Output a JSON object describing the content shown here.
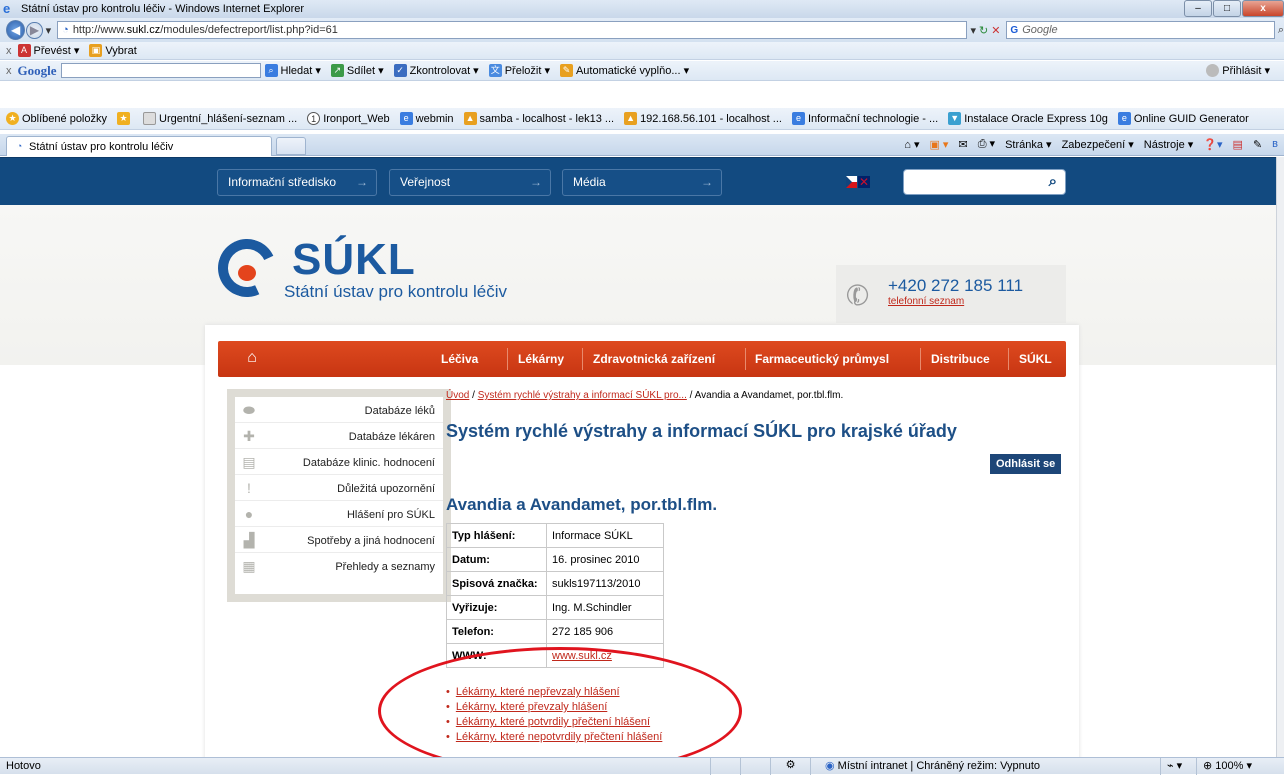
{
  "window": {
    "title": "Státní ústav pro kontrolu léčiv - Windows Internet Explorer"
  },
  "address": {
    "url_prefix": "http://www.",
    "url_host": "sukl.cz",
    "url_path": "/modules/defectreport/list.php?id=61",
    "search_placeholder": "Google"
  },
  "toolbar1": {
    "convert": "Převést",
    "select": "Vybrat"
  },
  "google_toolbar": {
    "logo": "Google",
    "search": "Hledat",
    "share": "Sdílet",
    "check": "Zkontrolovat",
    "translate": "Přeložit",
    "autofill": "Automatické vyplňo...",
    "signin": "Přihlásit"
  },
  "favorites": {
    "label": "Oblíbené položky",
    "items": [
      "Urgentní_hlášení-seznam ...",
      "Ironport_Web",
      "webmin",
      "samba - localhost - lek13 ...",
      "192.168.56.101 - localhost ...",
      "Informační technologie - ...",
      "Instalace Oracle Express 10g",
      "Online GUID Generator"
    ]
  },
  "tab": {
    "title": "Státní ústav pro kontrolu léčiv"
  },
  "commandbar": {
    "page": "Stránka",
    "security": "Zabezpečení",
    "tools": "Nástroje"
  },
  "site": {
    "topnav": [
      "Informační středisko",
      "Veřejnost",
      "Média"
    ],
    "logo_name": "SÚKL",
    "logo_sub": "Státní ústav pro kontrolu léčiv",
    "phone": "+420 272 185 111",
    "phone_link": "telefonní seznam",
    "mainnav": [
      "Léčiva",
      "Lékárny",
      "Zdravotnická zařízení",
      "Farmaceutický průmysl",
      "Distribuce",
      "SÚKL"
    ],
    "sidemenu": [
      "Databáze léků",
      "Databáze lékáren",
      "Databáze klinic. hodnocení",
      "Důležitá upozornění",
      "Hlášení pro SÚKL",
      "Spotřeby a jiná hodnocení",
      "Přehledy a seznamy"
    ],
    "breadcrumb": {
      "home": "Úvod",
      "sep": " / ",
      "section": "Systém rychlé výstrahy a informací SÚKL pro...",
      "current": "Avandia a Avandamet, por.tbl.flm."
    },
    "page_title": "Systém rychlé výstrahy a informací SÚKL pro krajské úřady",
    "logout": "Odhlásit se",
    "item_title": "Avandia a Avandamet, por.tbl.flm.",
    "info_rows": [
      {
        "k": "Typ hlášení:",
        "v": "Informace SÚKL"
      },
      {
        "k": "Datum:",
        "v": "16. prosinec 2010"
      },
      {
        "k": "Spisová značka:",
        "v": "sukls197113/2010"
      },
      {
        "k": "Vyřizuje:",
        "v": "Ing. M.Schindler"
      },
      {
        "k": "Telefon:",
        "v": "272 185 906"
      },
      {
        "k": "WWW:",
        "v": "www.sukl.cz"
      }
    ],
    "report_links": [
      "Lékárny, které nepřevzaly hlášení",
      "Lékárny, které převzaly hlášení",
      "Lékárny, které potvrdily přečtení hlášení",
      "Lékárny, které nepotvrdily přečtení hlášení"
    ]
  },
  "status": {
    "text": "Hotovo",
    "zone": "Místní intranet | Chráněný režim: Vypnuto",
    "zoom": "100%"
  },
  "colors": {
    "site_navy": "#124a80",
    "nav_orange": "#d8401a",
    "link_red": "#c0281b",
    "title_blue": "#1d4f86",
    "annotation_red": "#e0141e"
  }
}
